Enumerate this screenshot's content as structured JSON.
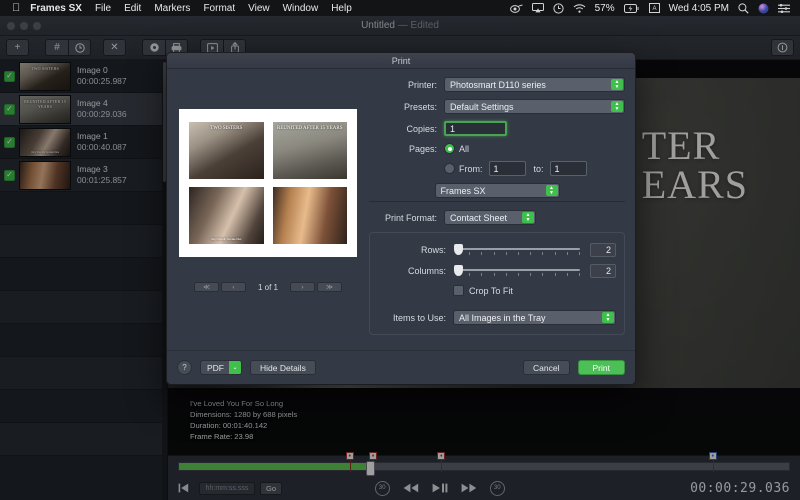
{
  "menubar": {
    "apple": "apple-logo",
    "items": [
      {
        "label": "Frames SX",
        "bold": true
      },
      {
        "label": "File"
      },
      {
        "label": "Edit"
      },
      {
        "label": "Markers"
      },
      {
        "label": "Format"
      },
      {
        "label": "View"
      },
      {
        "label": "Window"
      },
      {
        "label": "Help"
      }
    ],
    "status": {
      "battery": "57%",
      "clock": "Wed 4:05 PM",
      "icons": [
        "creative-cloud-icon",
        "airplay-icon",
        "time-machine-icon",
        "wifi-icon",
        "battery-icon",
        "input-source-icon",
        "search-icon",
        "siri-icon",
        "control-center-icon"
      ]
    }
  },
  "window": {
    "title": "Untitled",
    "title_suffix": "— Edited",
    "toolbar": {
      "add": "+",
      "marker": "#",
      "clock": "◔",
      "delete": "✕",
      "record": "◉",
      "print": "⎙",
      "export": "▶",
      "share": "⤒",
      "info": "ⓘ"
    }
  },
  "sidebar": {
    "images": [
      {
        "name": "Image 0",
        "time": "00:00:25.987",
        "checked": true,
        "caption": "TWO SISTERS",
        "caption_bottom": ""
      },
      {
        "name": "Image 4",
        "time": "00:00:29.036",
        "checked": true,
        "caption": "REUNITED AFTER 15 YEARS",
        "caption_bottom": ""
      },
      {
        "name": "Image 1",
        "time": "00:00:40.087",
        "checked": true,
        "caption": "",
        "caption_bottom": "Very friendly female files"
      },
      {
        "name": "Image 3",
        "time": "00:01:25.857",
        "checked": true,
        "caption": "",
        "caption_bottom": ""
      }
    ],
    "check_glyph": "✓"
  },
  "stage": {
    "video_text_line1": "TER",
    "video_text_line2": "EARS",
    "metadata": {
      "title": "I've Loved You For So Long",
      "dimensions": "Dimensions: 1280 by 688 pixels",
      "duration": "Duration: 00:01:40.142",
      "framerate": "Frame Rate: 23.98"
    }
  },
  "transport": {
    "go_label": "Go",
    "time_placeholder": "hh:mm:ss.sss",
    "timecode": "00:00:29.036",
    "buttons": {
      "start": "⏮",
      "back30": "30",
      "rewind": "◀◀",
      "playpause": "▶❙❙",
      "forward": "▶▶",
      "fwd30": "30"
    },
    "track_fill_percent": 31,
    "markers": [
      {
        "position": 28,
        "color": "red"
      },
      {
        "position": 31.8,
        "color": "red"
      },
      {
        "position": 43,
        "color": "red"
      },
      {
        "position": 87.5,
        "color": "blue"
      }
    ],
    "playhead_position": 31.5
  },
  "dialog": {
    "title": "Print",
    "printer_label": "Printer:",
    "printer_value": "Photosmart D110 series",
    "presets_label": "Presets:",
    "presets_value": "Default Settings",
    "copies_label": "Copies:",
    "copies_value": "1",
    "pages_label": "Pages:",
    "pages_all_label": "All",
    "pages_all_selected": true,
    "pages_from_label": "From:",
    "pages_from_value": "1",
    "pages_to_label": "to:",
    "pages_to_value": "1",
    "app_popup_value": "Frames SX",
    "print_format_label": "Print Format:",
    "print_format_value": "Contact Sheet",
    "rows_label": "Rows:",
    "rows_value": "2",
    "columns_label": "Columns:",
    "columns_value": "2",
    "crop_to_fit_label": "Crop To Fit",
    "crop_to_fit_checked": false,
    "items_to_use_label": "Items to Use:",
    "items_to_use_value": "All Images in the Tray",
    "preview": {
      "page_label": "1 of 1",
      "first_glyph": "≪",
      "prev_glyph": "‹",
      "next_glyph": "›",
      "last_glyph": "≫",
      "cells": [
        {
          "caption": "TWO SISTERS",
          "caption_bottom": ""
        },
        {
          "caption": "REUNITED AFTER 15 YEARS",
          "caption_bottom": ""
        },
        {
          "caption": "",
          "caption_bottom": "Very friendly female files"
        },
        {
          "caption": "",
          "caption_bottom": ""
        }
      ]
    },
    "footer": {
      "help": "?",
      "pdf": "PDF",
      "pdf_arrow": "⌄",
      "hide_details": "Hide Details",
      "cancel": "Cancel",
      "print": "Print"
    }
  },
  "colors": {
    "accent_green": "#3fbf4c",
    "print_button": "#4cc057",
    "dialog_bg": "#343a45",
    "marker_red": "#c23b3b",
    "marker_blue": "#3a6fd0"
  }
}
